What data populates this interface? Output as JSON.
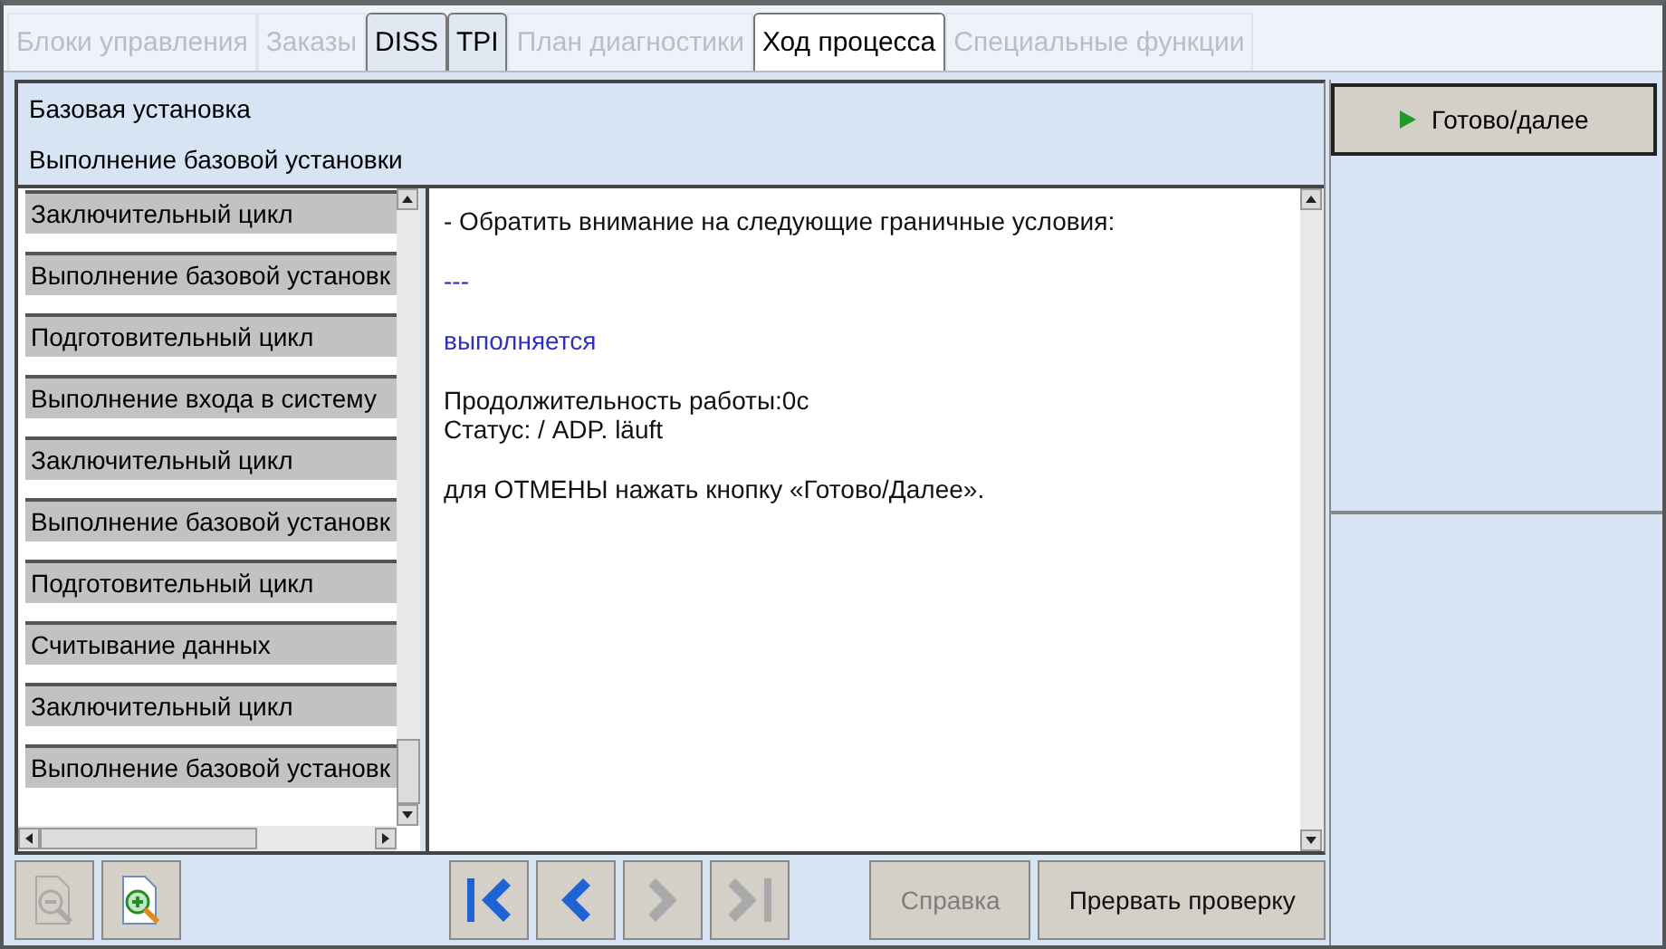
{
  "tabs": [
    {
      "label": "Блоки управления",
      "selected": false,
      "disabled": true
    },
    {
      "label": "Заказы",
      "selected": false,
      "disabled": true
    },
    {
      "label": "DISS",
      "selected": false,
      "disabled": false
    },
    {
      "label": "TPI",
      "selected": false,
      "disabled": false
    },
    {
      "label": "План диагностики",
      "selected": false,
      "disabled": true
    },
    {
      "label": "Ход процесса",
      "selected": true,
      "disabled": false
    },
    {
      "label": "Специальные функции",
      "selected": false,
      "disabled": true
    }
  ],
  "header": {
    "title": "Базовая установка",
    "subtitle": "Выполнение базовой установки"
  },
  "steps": [
    {
      "label": "Заключительный цикл"
    },
    {
      "label": "Выполнение базовой установк"
    },
    {
      "label": "Подготовительный цикл"
    },
    {
      "label": "Выполнение входа в систему"
    },
    {
      "label": "Заключительный цикл"
    },
    {
      "label": "Выполнение базовой установк"
    },
    {
      "label": "Подготовительный цикл"
    },
    {
      "label": "Считывание данных"
    },
    {
      "label": "Заключительный цикл"
    },
    {
      "label": "Выполнение базовой установк"
    }
  ],
  "message": [
    {
      "kind": "text",
      "lines": [
        "- Обратить внимание на следующие граничные условия:"
      ]
    },
    {
      "kind": "status",
      "lines": [
        "---"
      ]
    },
    {
      "kind": "status",
      "lines": [
        "выполняется"
      ]
    },
    {
      "kind": "text",
      "lines": [
        "Продолжительность работы:0c",
        "Статус: / ADP. läuft"
      ]
    },
    {
      "kind": "text",
      "lines": [
        "для ОТМЕНЫ нажать кнопку «Готово/Далее»."
      ]
    }
  ],
  "zoom_buttons": [
    {
      "kind": "zoom-out",
      "disabled": true
    },
    {
      "kind": "zoom-in",
      "disabled": false
    }
  ],
  "nav_buttons": [
    {
      "kind": "first",
      "disabled": false
    },
    {
      "kind": "prev",
      "disabled": false
    },
    {
      "kind": "next",
      "disabled": true
    },
    {
      "kind": "last",
      "disabled": true
    }
  ],
  "actions": [
    {
      "label": "Справка",
      "disabled": true
    },
    {
      "label": "Прервать проверку",
      "disabled": false
    }
  ],
  "next_button": {
    "label": "Готово/далее"
  }
}
